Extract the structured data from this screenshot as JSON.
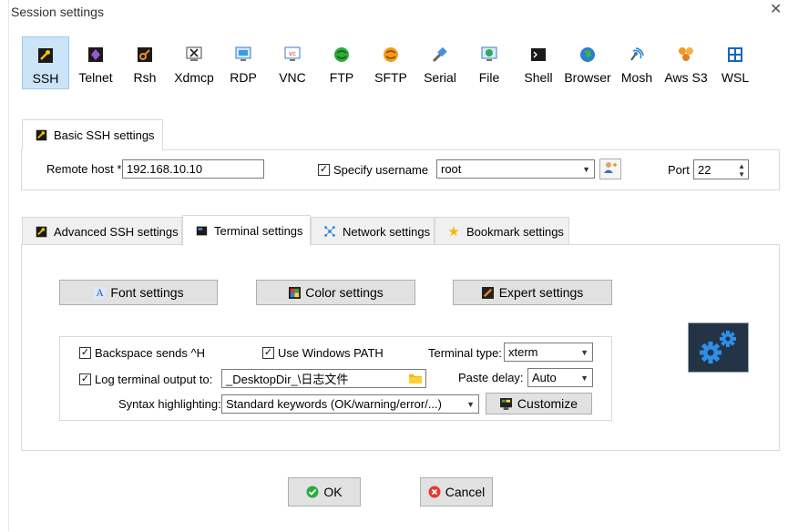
{
  "window": {
    "title": "Session settings"
  },
  "protocols": [
    {
      "label": "SSH",
      "icon": "ssh-key-icon",
      "selected": true
    },
    {
      "label": "Telnet",
      "icon": "telnet-icon"
    },
    {
      "label": "Rsh",
      "icon": "rsh-icon"
    },
    {
      "label": "Xdmcp",
      "icon": "xdmcp-icon"
    },
    {
      "label": "RDP",
      "icon": "rdp-icon"
    },
    {
      "label": "VNC",
      "icon": "vnc-icon"
    },
    {
      "label": "FTP",
      "icon": "ftp-icon"
    },
    {
      "label": "SFTP",
      "icon": "sftp-icon"
    },
    {
      "label": "Serial",
      "icon": "serial-icon"
    },
    {
      "label": "File",
      "icon": "file-icon"
    },
    {
      "label": "Shell",
      "icon": "shell-icon"
    },
    {
      "label": "Browser",
      "icon": "browser-icon"
    },
    {
      "label": "Mosh",
      "icon": "mosh-icon"
    },
    {
      "label": "Aws S3",
      "icon": "aws-s3-icon"
    },
    {
      "label": "WSL",
      "icon": "wsl-icon"
    }
  ],
  "basic": {
    "tab_label": "Basic SSH settings",
    "remote_host_label": "Remote host *",
    "remote_host_value": "192.168.10.10",
    "specify_username_label": "Specify username",
    "username_value": "root",
    "port_label": "Port",
    "port_value": "22"
  },
  "tabs": [
    {
      "label": "Advanced SSH settings"
    },
    {
      "label": "Terminal settings",
      "active": true
    },
    {
      "label": "Network settings"
    },
    {
      "label": "Bookmark settings"
    }
  ],
  "terminal": {
    "font_settings": "Font settings",
    "color_settings": "Color settings",
    "expert_settings": "Expert settings",
    "backspace_label": "Backspace sends ^H",
    "windows_path_label": "Use Windows PATH",
    "terminal_type_label": "Terminal type:",
    "terminal_type_value": "xterm",
    "log_output_label": "Log terminal output to:",
    "log_path_value": "_DesktopDir_\\日志文件",
    "paste_delay_label": "Paste delay:",
    "paste_delay_value": "Auto",
    "syntax_label": "Syntax highlighting:",
    "syntax_value": "Standard keywords (OK/warning/error/...)",
    "customize_label": "Customize"
  },
  "footer": {
    "ok": "OK",
    "cancel": "Cancel"
  },
  "colors": {
    "selected_bg": "#cce4f7",
    "gear_bg": "#243447",
    "gear_blue": "#2e8ee8"
  }
}
